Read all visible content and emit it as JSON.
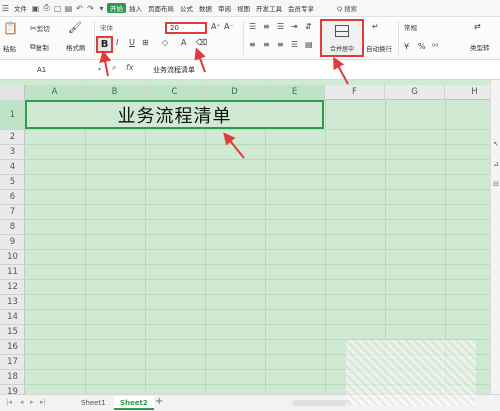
{
  "menubar": {
    "file": "文件",
    "tabs": [
      "开始",
      "插入",
      "页面布局",
      "公式",
      "数据",
      "审阅",
      "视图",
      "开发工具",
      "会员专享"
    ],
    "active_tab": "开始",
    "search": "Q 搜索"
  },
  "ribbon": {
    "paste": "粘贴",
    "cut": "剪切",
    "copy": "复制",
    "format_painter": "格式刷",
    "font_name": "宋体",
    "bold": "B",
    "font_size": "20",
    "merge_center": "合并居中",
    "wrap_text": "自动换行",
    "number_format": "常规",
    "type_convert": "类型转"
  },
  "formula_bar": {
    "cell_ref": "A1",
    "fx": "fx",
    "content": "业务流程清单"
  },
  "grid": {
    "columns": [
      "A",
      "B",
      "C",
      "D",
      "E",
      "F",
      "G",
      "H"
    ],
    "selected_columns": [
      "A",
      "B",
      "C",
      "D",
      "E"
    ],
    "rows": [
      "1",
      "2",
      "3",
      "4",
      "5",
      "6",
      "7",
      "8",
      "9",
      "10",
      "11",
      "12",
      "13",
      "14",
      "15",
      "16",
      "17",
      "18",
      "19"
    ],
    "merged_cell_text": "业务流程清单"
  },
  "sheets": {
    "tabs": [
      "Sheet1",
      "Sheet2"
    ],
    "active": "Sheet2",
    "add": "+"
  },
  "colors": {
    "accent": "#2e9c4e",
    "annotation": "#e23b3b",
    "grid_fill": "#cfe9d2"
  }
}
